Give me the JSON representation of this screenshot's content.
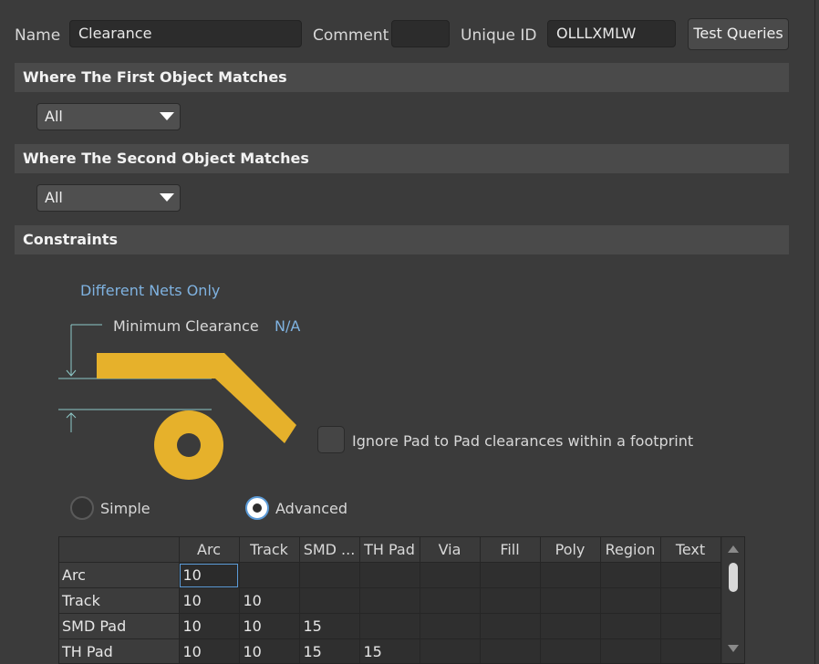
{
  "header": {
    "name_label": "Name",
    "name_value": "Clearance",
    "comment_label": "Comment",
    "comment_value": "",
    "uid_label": "Unique ID",
    "uid_value": "OLLLXMLW",
    "test_queries": "Test Queries"
  },
  "first_match": {
    "title": "Where The First Object Matches",
    "value": "All"
  },
  "second_match": {
    "title": "Where The Second Object Matches",
    "value": "All"
  },
  "constraints": {
    "title": "Constraints",
    "nets": "Different Nets Only",
    "min_label": "Minimum Clearance",
    "min_value": "N/A",
    "ignore_pad": "Ignore Pad to Pad clearances within a footprint",
    "ignore_pad_checked": false,
    "mode_simple": "Simple",
    "mode_advanced": "Advanced",
    "selected_mode": "Advanced"
  },
  "colors": {
    "copper": "#e6b12b",
    "accent": "#5b9ad6",
    "link": "#7fb2e0"
  },
  "matrix": {
    "columns": [
      "Arc",
      "Track",
      "SMD ...",
      "TH Pad",
      "Via",
      "Fill",
      "Poly",
      "Region",
      "Text"
    ],
    "rows": [
      {
        "label": "Arc",
        "values": [
          "10",
          "",
          "",
          "",
          "",
          "",
          "",
          "",
          ""
        ]
      },
      {
        "label": "Track",
        "values": [
          "10",
          "10",
          "",
          "",
          "",
          "",
          "",
          "",
          ""
        ]
      },
      {
        "label": "SMD Pad",
        "values": [
          "10",
          "10",
          "15",
          "",
          "",
          "",
          "",
          "",
          ""
        ]
      },
      {
        "label": "TH Pad",
        "values": [
          "10",
          "10",
          "15",
          "15",
          "",
          "",
          "",
          "",
          ""
        ]
      }
    ]
  }
}
